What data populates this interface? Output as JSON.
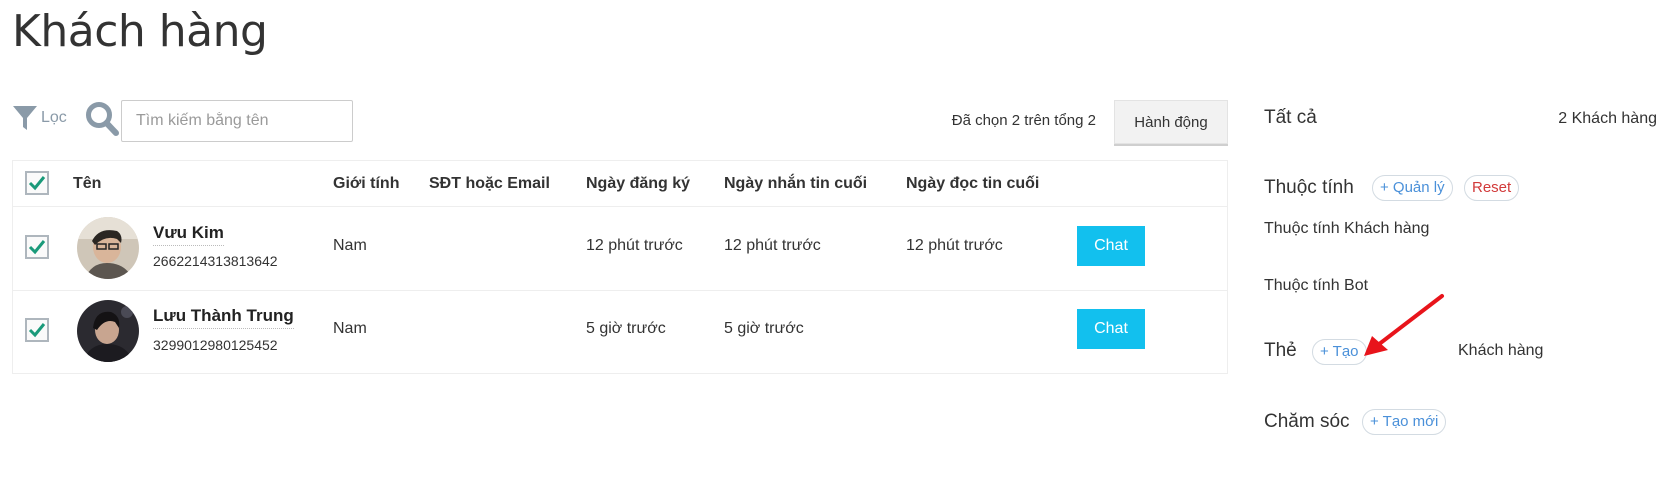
{
  "page": {
    "title": "Khách hàng"
  },
  "toolbar": {
    "filter_label": "Lọc",
    "search_placeholder": "Tìm kiếm bằng tên",
    "selection_text": "Đã chọn 2 trên tổng 2",
    "action_label": "Hành động"
  },
  "table": {
    "columns": [
      "Tên",
      "Giới tính",
      "SĐT hoặc Email",
      "Ngày đăng ký",
      "Ngày nhắn tin cuối",
      "Ngày đọc tin cuối"
    ],
    "rows": [
      {
        "name": "Vưu Kim",
        "id": "2662214313813642",
        "gender": "Nam",
        "contact": "",
        "registered": "12 phút trước",
        "last_message": "12 phút trước",
        "last_read": "12 phút trước",
        "chat_label": "Chat",
        "checked": true
      },
      {
        "name": "Lưu Thành Trung",
        "id": "3299012980125452",
        "gender": "Nam",
        "contact": "",
        "registered": "5 giờ trước",
        "last_message": "5 giờ trước",
        "last_read": "",
        "chat_label": "Chat",
        "checked": true
      }
    ]
  },
  "sidebar": {
    "all_label": "Tất cả",
    "all_count": "2 Khách hàng",
    "attributes_title": "Thuộc tính",
    "manage_label": "+ Quản lý",
    "reset_label": "Reset",
    "customer_attributes": "Thuộc tính Khách hàng",
    "bot_attributes": "Thuộc tính Bot",
    "tags_title": "Thẻ",
    "create_tag_label": "+ Tạo",
    "tag_item": "Khách hàng",
    "care_title": "Chăm sóc",
    "create_care_label": "+ Tạo mới"
  },
  "colors": {
    "accent": "#12c0ee",
    "checkmark": "#1a9a7a",
    "pill_blue": "#4a90d9",
    "pill_red": "#d23a3a",
    "arrow": "#e8141b"
  }
}
